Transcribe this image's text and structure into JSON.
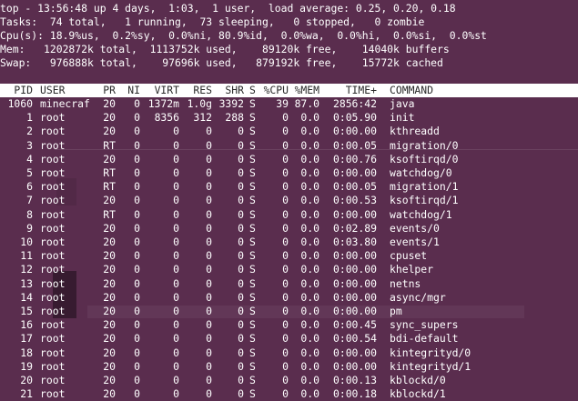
{
  "summary": {
    "line1": "top - 13:56:48 up 4 days,  1:03,  1 user,  load average: 0.25, 0.20, 0.18",
    "line2": "Tasks:  74 total,   1 running,  73 sleeping,   0 stopped,   0 zombie",
    "line3": "Cpu(s): 18.9%us,  0.2%sy,  0.0%ni, 80.9%id,  0.0%wa,  0.0%hi,  0.0%si,  0.0%st",
    "line4": "Mem:   1202872k total,  1113752k used,    89120k free,    14040k buffers",
    "line5": "Swap:   976888k total,    97696k used,   879192k free,    15772k cached"
  },
  "columns": [
    "PID",
    "USER",
    "PR",
    "NI",
    "VIRT",
    "RES",
    "SHR",
    "S",
    "%CPU",
    "%MEM",
    "TIME+",
    "COMMAND"
  ],
  "processes": [
    [
      "1060",
      "minecraf",
      "20",
      "0",
      "1372m",
      "1.0g",
      "3392",
      "S",
      "39",
      "87.0",
      "2856:42",
      "java"
    ],
    [
      "1",
      "root",
      "20",
      "0",
      "8356",
      "312",
      "288",
      "S",
      "0",
      "0.0",
      "0:05.90",
      "init"
    ],
    [
      "2",
      "root",
      "20",
      "0",
      "0",
      "0",
      "0",
      "S",
      "0",
      "0.0",
      "0:00.00",
      "kthreadd"
    ],
    [
      "3",
      "root",
      "RT",
      "0",
      "0",
      "0",
      "0",
      "S",
      "0",
      "0.0",
      "0:00.05",
      "migration/0"
    ],
    [
      "4",
      "root",
      "20",
      "0",
      "0",
      "0",
      "0",
      "S",
      "0",
      "0.0",
      "0:00.76",
      "ksoftirqd/0"
    ],
    [
      "5",
      "root",
      "RT",
      "0",
      "0",
      "0",
      "0",
      "S",
      "0",
      "0.0",
      "0:00.00",
      "watchdog/0"
    ],
    [
      "6",
      "root",
      "RT",
      "0",
      "0",
      "0",
      "0",
      "S",
      "0",
      "0.0",
      "0:00.05",
      "migration/1"
    ],
    [
      "7",
      "root",
      "20",
      "0",
      "0",
      "0",
      "0",
      "S",
      "0",
      "0.0",
      "0:00.53",
      "ksoftirqd/1"
    ],
    [
      "8",
      "root",
      "RT",
      "0",
      "0",
      "0",
      "0",
      "S",
      "0",
      "0.0",
      "0:00.00",
      "watchdog/1"
    ],
    [
      "9",
      "root",
      "20",
      "0",
      "0",
      "0",
      "0",
      "S",
      "0",
      "0.0",
      "0:02.89",
      "events/0"
    ],
    [
      "10",
      "root",
      "20",
      "0",
      "0",
      "0",
      "0",
      "S",
      "0",
      "0.0",
      "0:03.80",
      "events/1"
    ],
    [
      "11",
      "root",
      "20",
      "0",
      "0",
      "0",
      "0",
      "S",
      "0",
      "0.0",
      "0:00.00",
      "cpuset"
    ],
    [
      "12",
      "root",
      "20",
      "0",
      "0",
      "0",
      "0",
      "S",
      "0",
      "0.0",
      "0:00.00",
      "khelper"
    ],
    [
      "13",
      "root",
      "20",
      "0",
      "0",
      "0",
      "0",
      "S",
      "0",
      "0.0",
      "0:00.00",
      "netns"
    ],
    [
      "14",
      "root",
      "20",
      "0",
      "0",
      "0",
      "0",
      "S",
      "0",
      "0.0",
      "0:00.00",
      "async/mgr"
    ],
    [
      "15",
      "root",
      "20",
      "0",
      "0",
      "0",
      "0",
      "S",
      "0",
      "0.0",
      "0:00.00",
      "pm"
    ],
    [
      "16",
      "root",
      "20",
      "0",
      "0",
      "0",
      "0",
      "S",
      "0",
      "0.0",
      "0:00.45",
      "sync_supers"
    ],
    [
      "17",
      "root",
      "20",
      "0",
      "0",
      "0",
      "0",
      "S",
      "0",
      "0.0",
      "0:00.54",
      "bdi-default"
    ],
    [
      "18",
      "root",
      "20",
      "0",
      "0",
      "0",
      "0",
      "S",
      "0",
      "0.0",
      "0:00.00",
      "kintegrityd/0"
    ],
    [
      "19",
      "root",
      "20",
      "0",
      "0",
      "0",
      "0",
      "S",
      "0",
      "0.0",
      "0:00.00",
      "kintegrityd/1"
    ],
    [
      "20",
      "root",
      "20",
      "0",
      "0",
      "0",
      "0",
      "S",
      "0",
      "0.0",
      "0:00.13",
      "kblockd/0"
    ],
    [
      "21",
      "root",
      "20",
      "0",
      "0",
      "0",
      "0",
      "S",
      "0",
      "0.0",
      "0:00.18",
      "kblockd/1"
    ]
  ],
  "colors": {
    "terminal_bg": "#5a2d4e",
    "text": "#ffffff",
    "header_bg": "#ffffff",
    "header_text": "#2a2a2a"
  }
}
